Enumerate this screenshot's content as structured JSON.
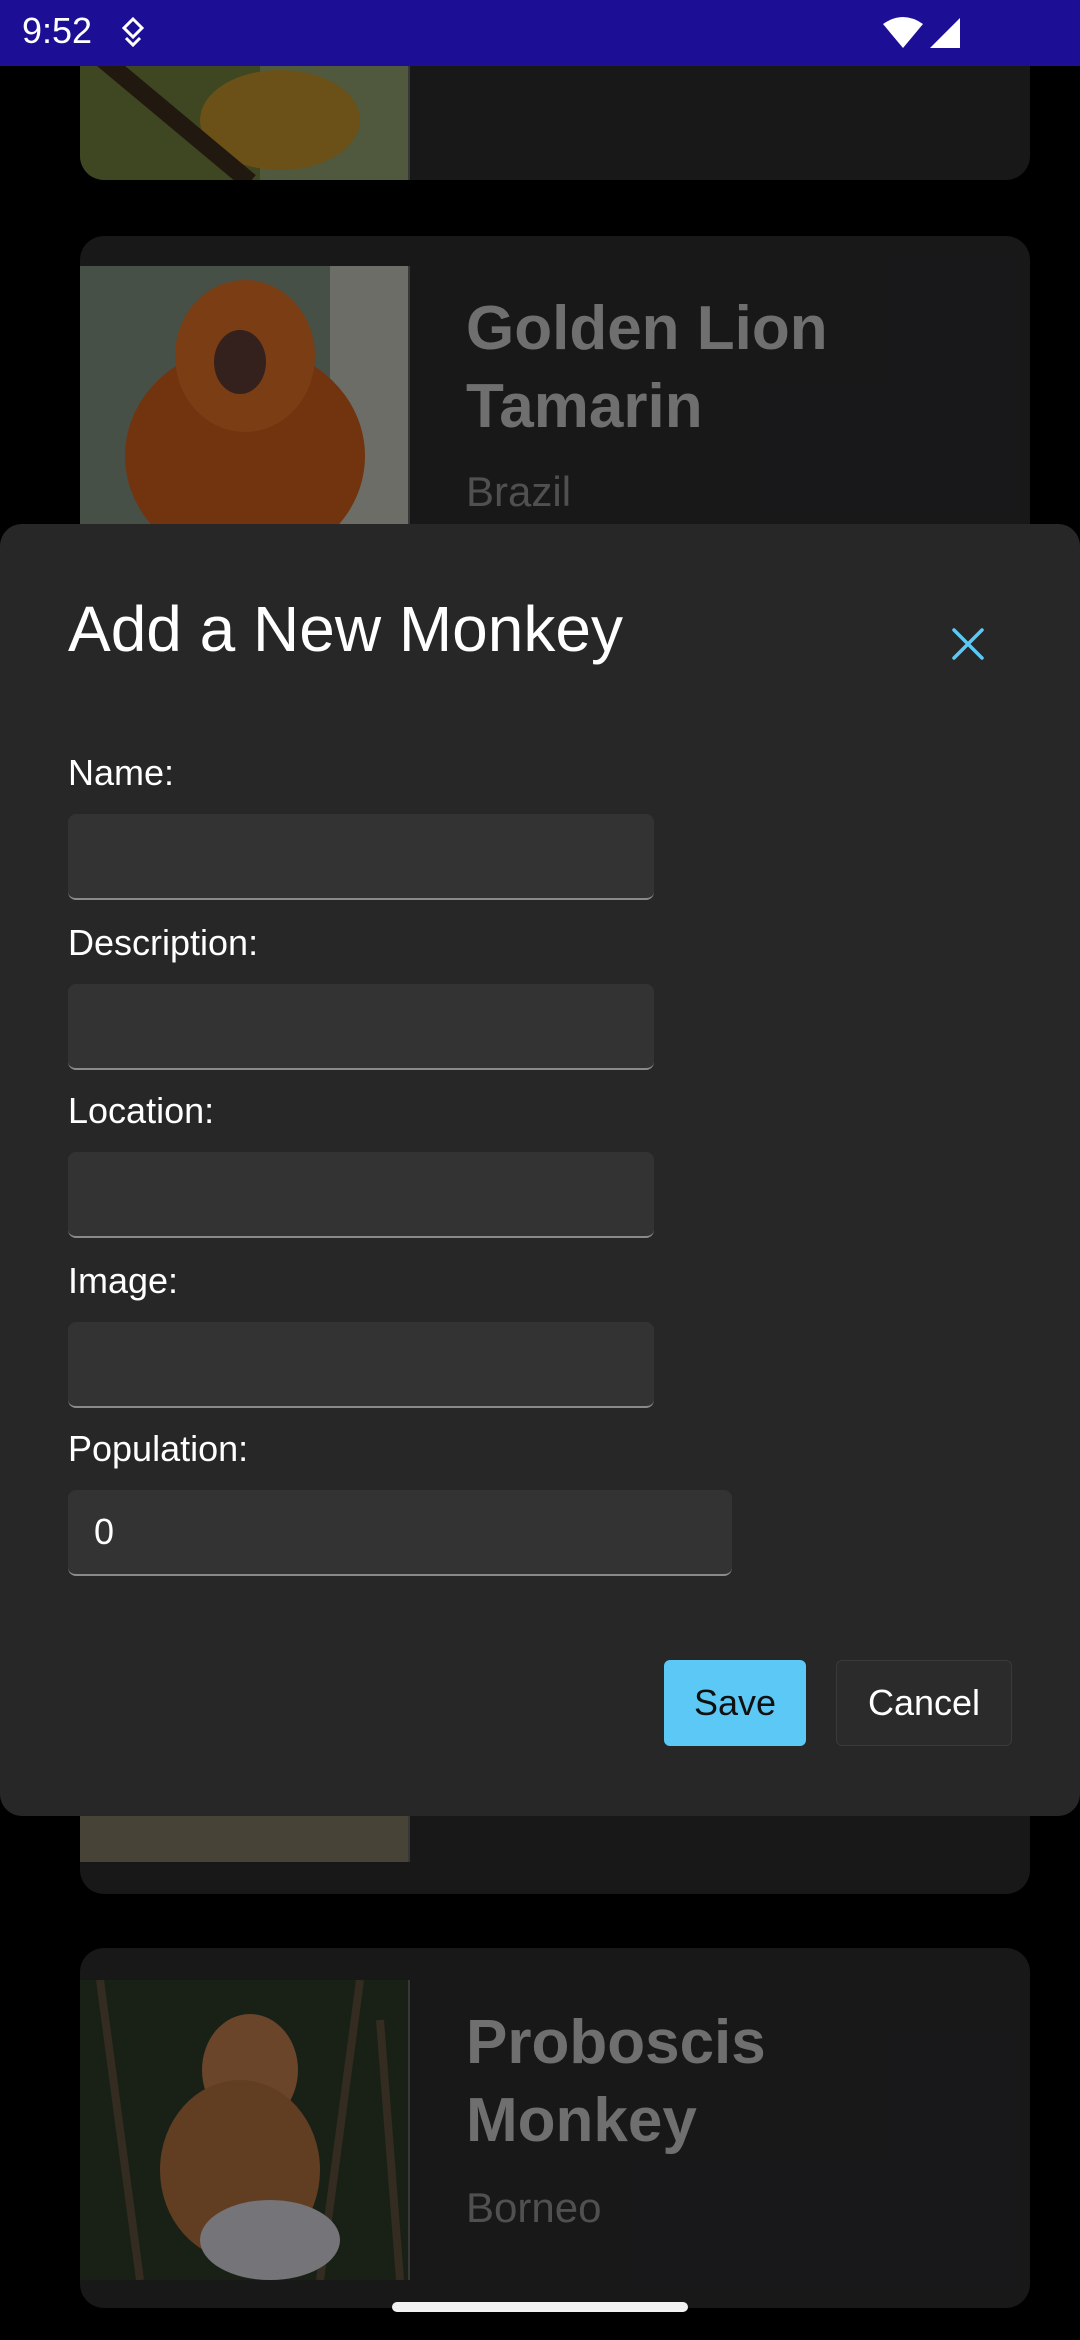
{
  "status_bar": {
    "time": "9:52"
  },
  "cards": [
    {
      "title": "",
      "location": ""
    },
    {
      "title": "Golden Lion Tamarin",
      "location": "Brazil"
    },
    {
      "title": "",
      "location": ""
    },
    {
      "title": "Proboscis Monkey",
      "location": "Borneo"
    }
  ],
  "dialog": {
    "title": "Add a New Monkey",
    "close_icon": "close-icon",
    "fields": [
      {
        "label": "Name:",
        "value": ""
      },
      {
        "label": "Description:",
        "value": ""
      },
      {
        "label": "Location:",
        "value": ""
      },
      {
        "label": "Image:",
        "value": ""
      },
      {
        "label": "Population:",
        "value": "0"
      }
    ],
    "save_label": "Save",
    "cancel_label": "Cancel"
  },
  "colors": {
    "status_bar": "#1d0e96",
    "accent": "#5bc8f5",
    "sheet_bg": "#272727",
    "card_bg": "#2a2a2c"
  }
}
